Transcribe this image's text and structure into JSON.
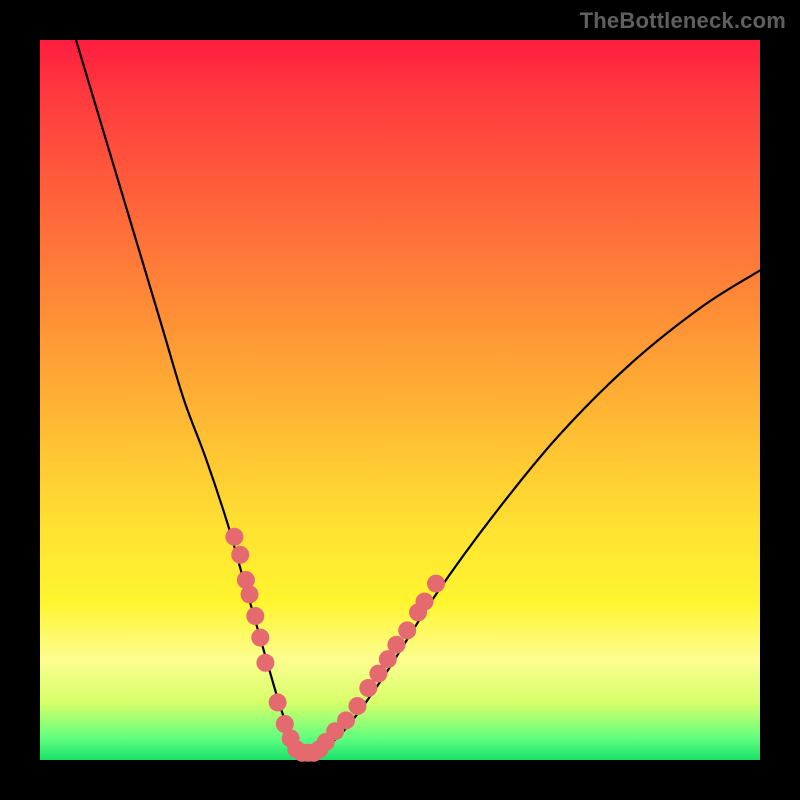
{
  "watermark": "TheBottleneck.com",
  "colors": {
    "curve_stroke": "#000000",
    "marker_fill": "#e46a6f",
    "marker_stroke": "#d15a60"
  },
  "chart_data": {
    "type": "line",
    "title": "",
    "xlabel": "",
    "ylabel": "",
    "xlim": [
      0,
      100
    ],
    "ylim": [
      0,
      100
    ],
    "series": [
      {
        "name": "bottleneck-curve",
        "x": [
          5,
          8,
          11,
          14,
          17,
          20,
          23,
          26,
          28,
          30,
          32,
          33.5,
          35,
          36.5,
          38,
          40,
          43,
          48,
          55,
          63,
          72,
          82,
          92,
          100
        ],
        "y": [
          100,
          90,
          80,
          70,
          60,
          50,
          42,
          33,
          26,
          19,
          12,
          7,
          3,
          1,
          1,
          2,
          5,
          12,
          23,
          34,
          45,
          55,
          63,
          68
        ]
      }
    ],
    "markers": {
      "name": "data-points",
      "points": [
        {
          "x": 27.0,
          "y": 31.0
        },
        {
          "x": 27.8,
          "y": 28.5
        },
        {
          "x": 28.6,
          "y": 25.0
        },
        {
          "x": 29.1,
          "y": 23.0
        },
        {
          "x": 29.9,
          "y": 20.0
        },
        {
          "x": 30.6,
          "y": 17.0
        },
        {
          "x": 31.3,
          "y": 13.5
        },
        {
          "x": 33.0,
          "y": 8.0
        },
        {
          "x": 34.0,
          "y": 5.0
        },
        {
          "x": 34.8,
          "y": 3.0
        },
        {
          "x": 35.6,
          "y": 1.5
        },
        {
          "x": 36.4,
          "y": 1.0
        },
        {
          "x": 37.2,
          "y": 1.0
        },
        {
          "x": 38.0,
          "y": 1.0
        },
        {
          "x": 38.8,
          "y": 1.5
        },
        {
          "x": 39.7,
          "y": 2.5
        },
        {
          "x": 41.0,
          "y": 4.0
        },
        {
          "x": 42.5,
          "y": 5.5
        },
        {
          "x": 44.1,
          "y": 7.5
        },
        {
          "x": 45.6,
          "y": 10.0
        },
        {
          "x": 47.0,
          "y": 12.0
        },
        {
          "x": 48.3,
          "y": 14.0
        },
        {
          "x": 49.5,
          "y": 16.0
        },
        {
          "x": 51.0,
          "y": 18.0
        },
        {
          "x": 52.5,
          "y": 20.5
        },
        {
          "x": 53.4,
          "y": 22.0
        },
        {
          "x": 55.0,
          "y": 24.5
        }
      ]
    }
  }
}
